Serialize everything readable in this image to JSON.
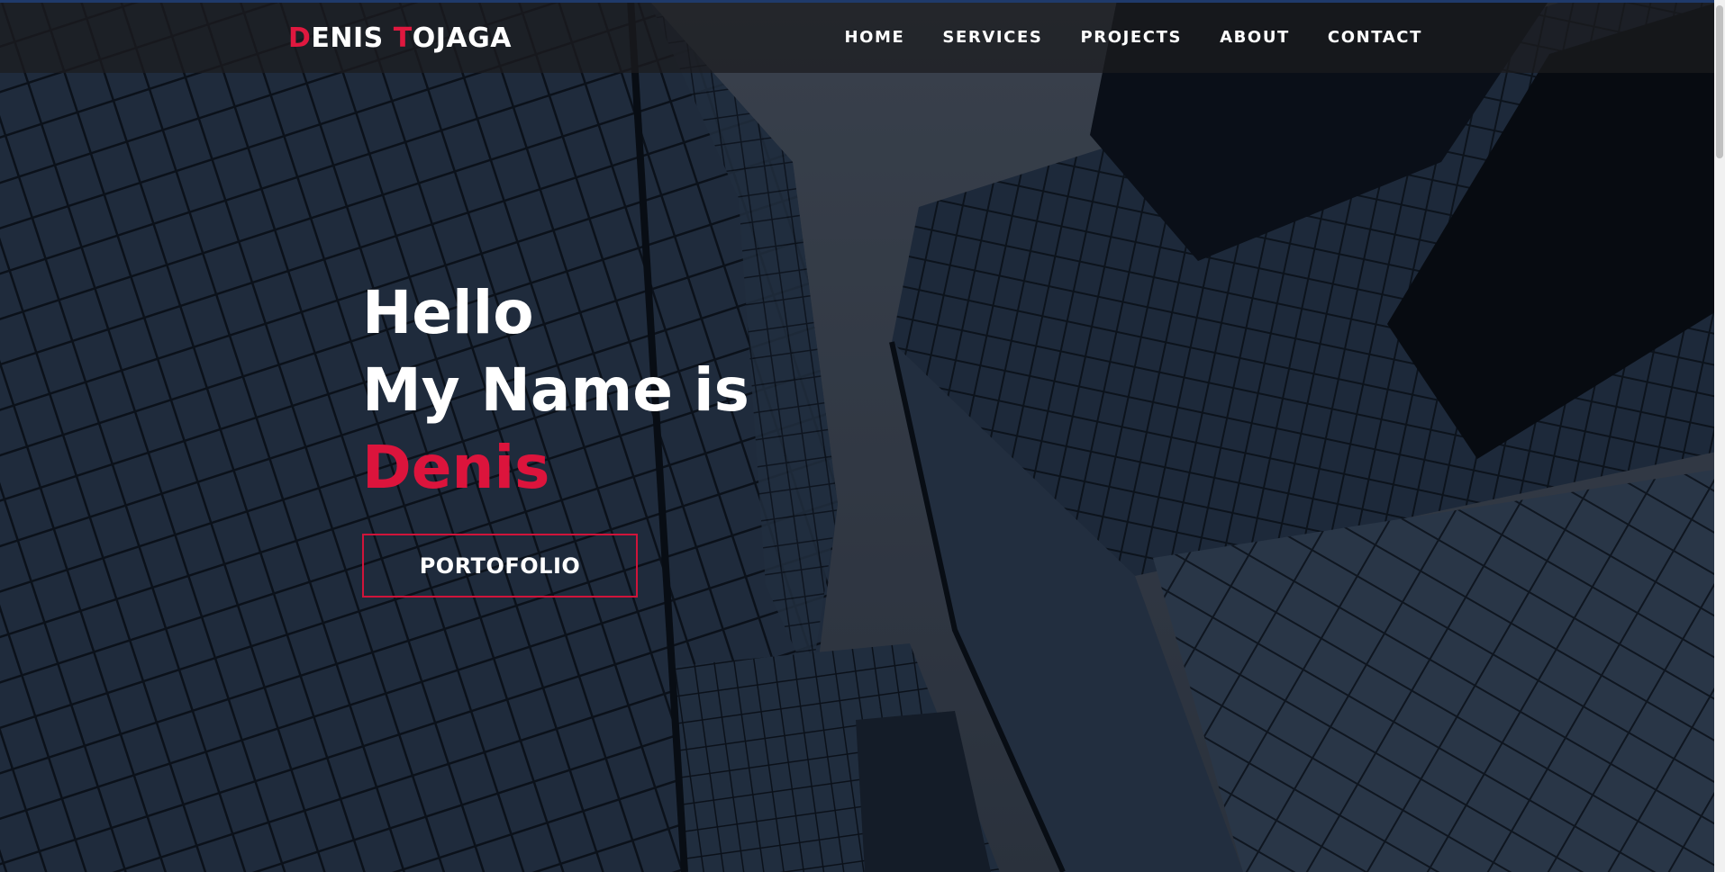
{
  "brand": {
    "first_initial": "D",
    "first_rest": "ENIS ",
    "last_initial": "T",
    "last_rest": "OJAGA"
  },
  "nav": {
    "items": [
      {
        "label": "HOME"
      },
      {
        "label": "SERVICES"
      },
      {
        "label": "PROJECTS"
      },
      {
        "label": "ABOUT"
      },
      {
        "label": "CONTACT"
      }
    ]
  },
  "hero": {
    "line1": "Hello",
    "line2": "My Name is",
    "line3": "Denis",
    "cta_label": "PORTOFOLIO"
  },
  "colors": {
    "accent": "#dc143c",
    "nav_background": "#1c1c1e",
    "text": "#ffffff"
  }
}
